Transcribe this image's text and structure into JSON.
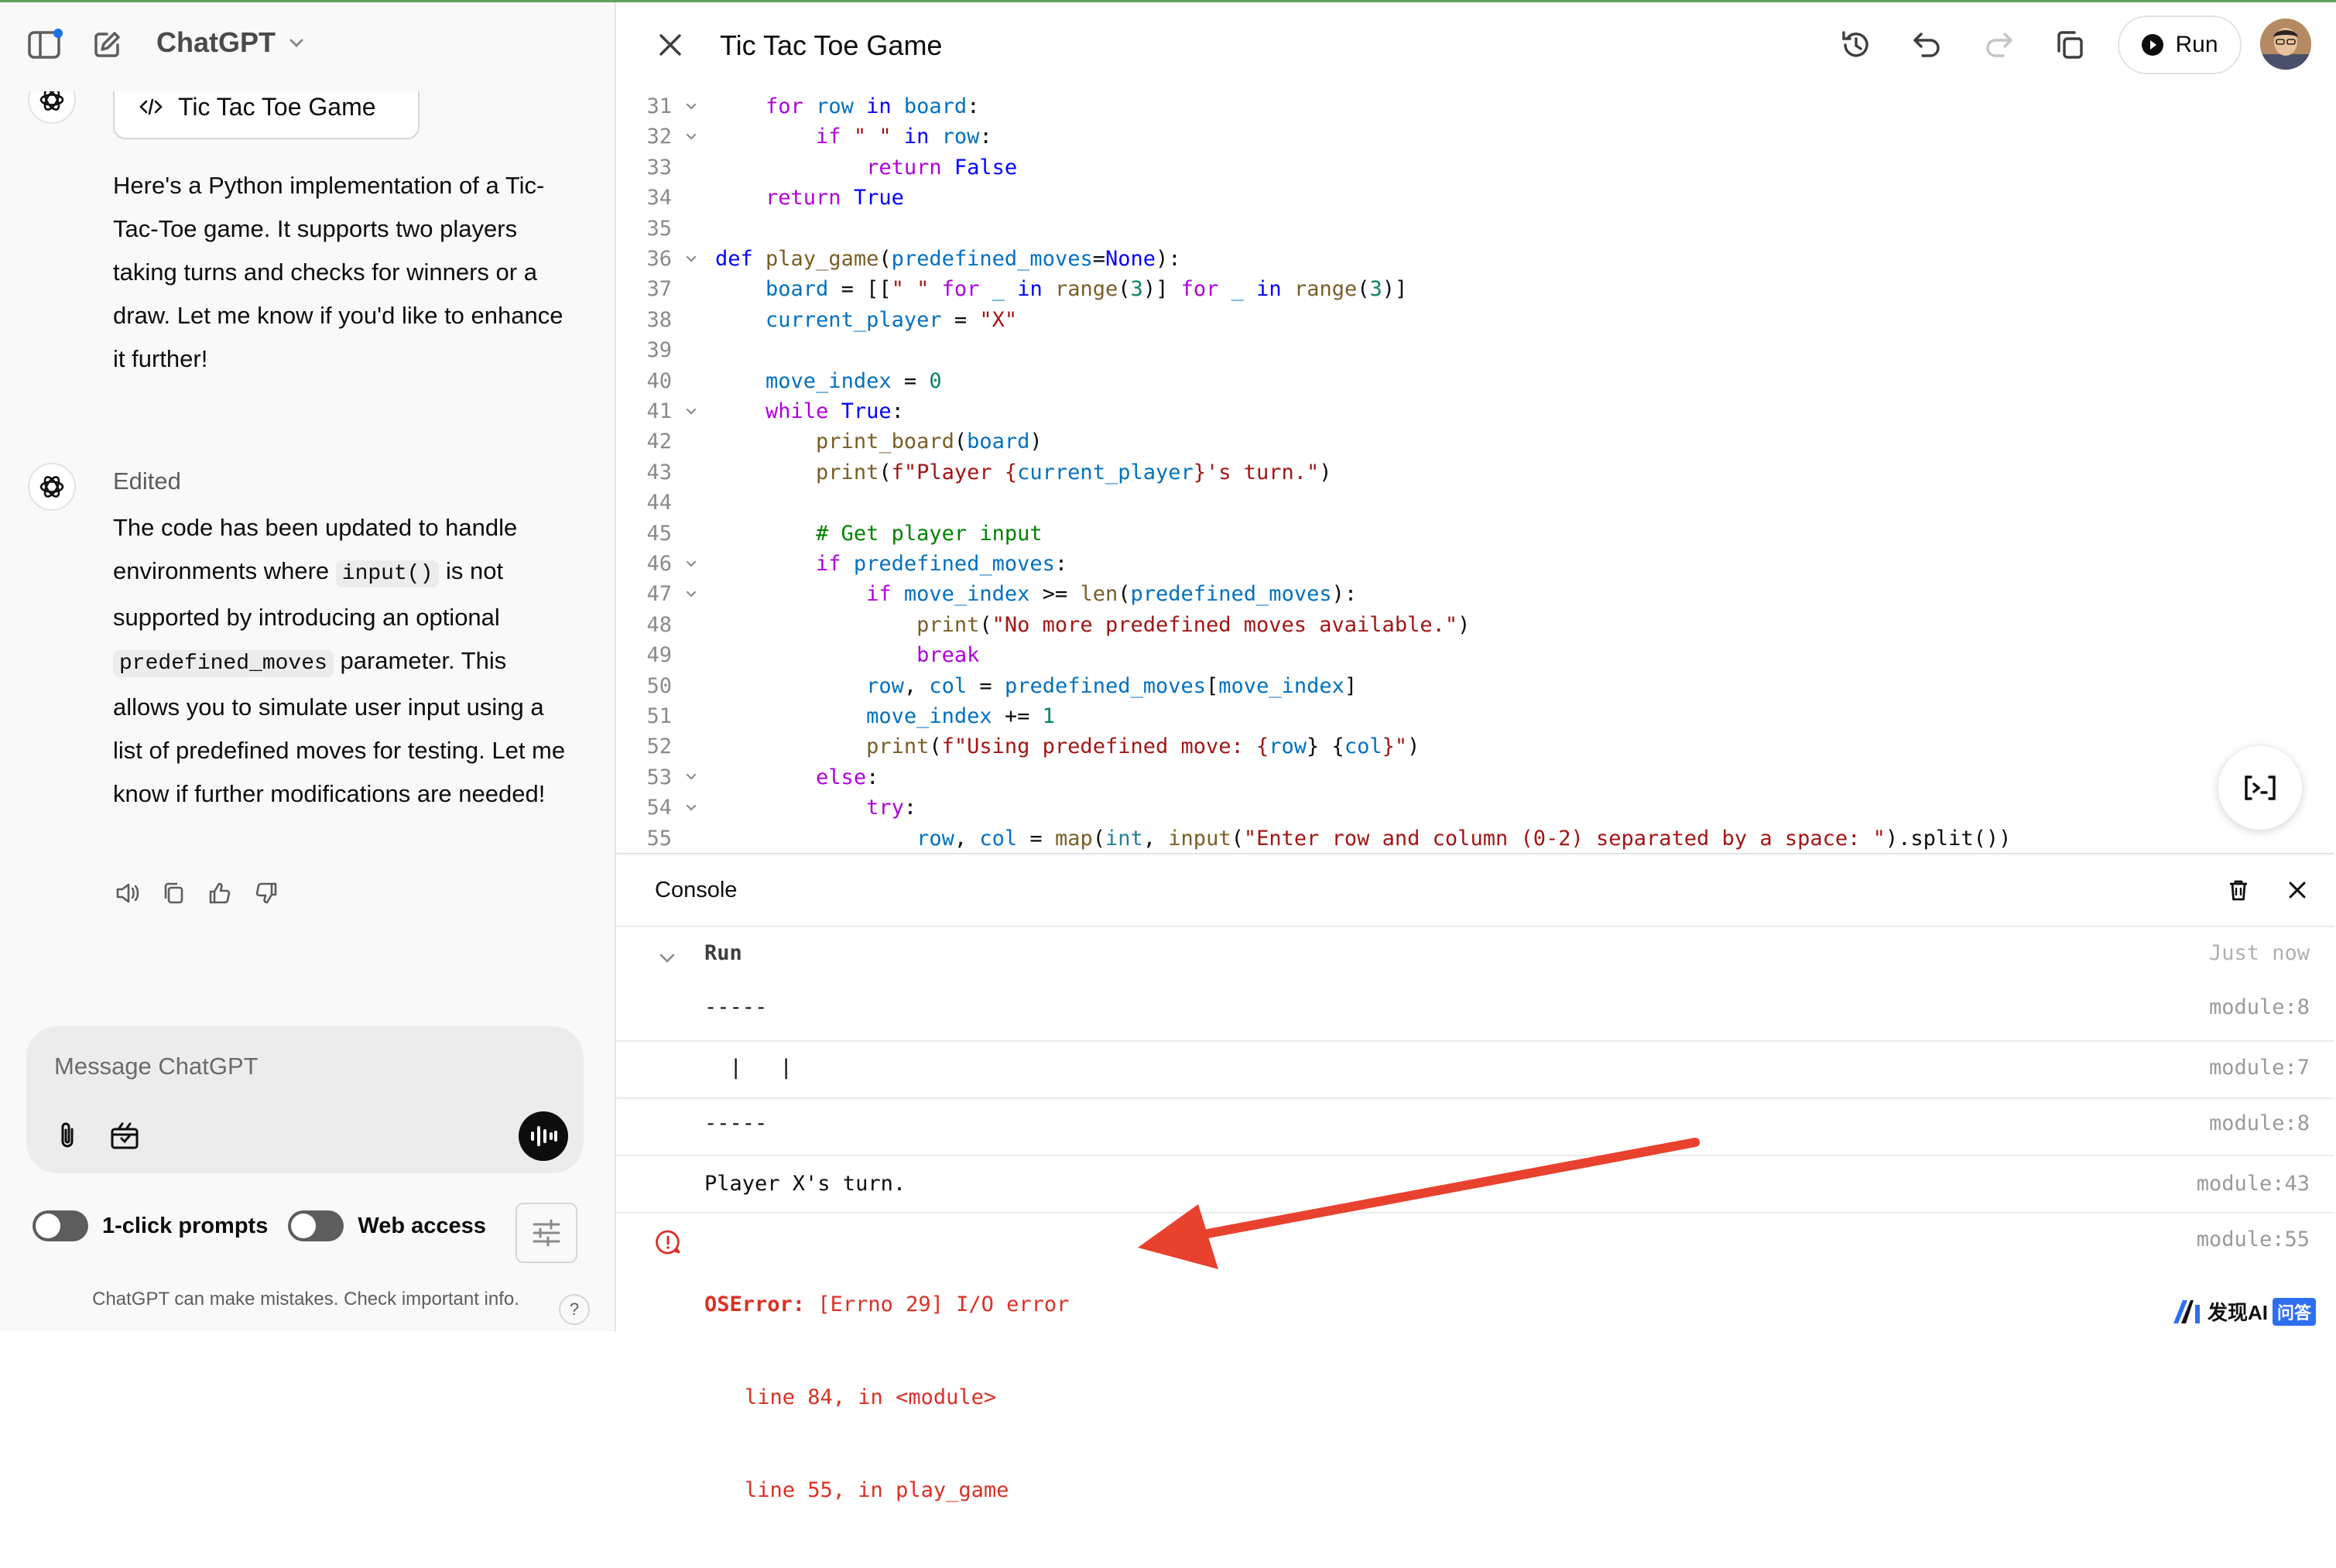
{
  "app": {
    "title": "ChatGPT"
  },
  "conversation": {
    "artifact_label": "Tic Tac Toe Game",
    "message1": "Here's a Python implementation of a Tic-Tac-Toe game. It supports two players taking turns and checks for winners or a draw. Let me know if you'd like to enhance it further!",
    "edited_label": "Edited",
    "message2": {
      "p1": "The code has been updated to handle environments where",
      "code1": "input()",
      "p2": "is not supported by introducing an optional",
      "code2": "predefined_moves",
      "p3": "parameter. This allows you to simulate user input using a list of predefined moves for testing. Let me know if further modifications are needed!"
    }
  },
  "composer": {
    "placeholder": "Message ChatGPT"
  },
  "toggles": {
    "one_click": "1-click prompts",
    "web_access": "Web access"
  },
  "footer": {
    "disclaimer": "ChatGPT can make mistakes. Check important info.",
    "help": "?"
  },
  "canvas": {
    "title": "Tic Tac Toe Game",
    "run_label": "Run"
  },
  "code_lines": [
    {
      "n": "31",
      "fold": true
    },
    {
      "n": "32",
      "fold": true
    },
    {
      "n": "33",
      "fold": false
    },
    {
      "n": "34",
      "fold": false
    },
    {
      "n": "35",
      "fold": false
    },
    {
      "n": "36",
      "fold": true
    },
    {
      "n": "37",
      "fold": false
    },
    {
      "n": "38",
      "fold": false
    },
    {
      "n": "39",
      "fold": false
    },
    {
      "n": "40",
      "fold": false
    },
    {
      "n": "41",
      "fold": true
    },
    {
      "n": "42",
      "fold": false
    },
    {
      "n": "43",
      "fold": false
    },
    {
      "n": "44",
      "fold": false
    },
    {
      "n": "45",
      "fold": false
    },
    {
      "n": "46",
      "fold": true
    },
    {
      "n": "47",
      "fold": true
    },
    {
      "n": "48",
      "fold": false
    },
    {
      "n": "49",
      "fold": false
    },
    {
      "n": "50",
      "fold": false
    },
    {
      "n": "51",
      "fold": false
    },
    {
      "n": "52",
      "fold": false
    },
    {
      "n": "53",
      "fold": true
    },
    {
      "n": "54",
      "fold": true
    },
    {
      "n": "55",
      "fold": false
    }
  ],
  "code_tokens": {
    "l31": [
      "    ",
      "for",
      " ",
      "row",
      " ",
      "in",
      " ",
      "board",
      ":"
    ],
    "l32": [
      "        ",
      "if",
      " ",
      "\" \"",
      " ",
      "in",
      " ",
      "row",
      ":"
    ],
    "l33": [
      "            ",
      "return",
      " ",
      "False"
    ],
    "l34": [
      "    ",
      "return",
      " ",
      "True"
    ],
    "l36": [
      "def",
      " ",
      "play_game",
      "(",
      "predefined_moves",
      "=",
      "None",
      "):"
    ],
    "l37": [
      "    ",
      "board",
      " = [[",
      "\" \"",
      " ",
      "for",
      " ",
      "_",
      " ",
      "in",
      " ",
      "range",
      "(",
      "3",
      ")] ",
      "for",
      " ",
      "_",
      " ",
      "in",
      " ",
      "range",
      "(",
      "3",
      ")]"
    ],
    "l38": [
      "    ",
      "current_player",
      " = ",
      "\"X\""
    ],
    "l40": [
      "    ",
      "move_index",
      " = ",
      "0"
    ],
    "l41": [
      "    ",
      "while",
      " ",
      "True",
      ":"
    ],
    "l42": [
      "        ",
      "print_board",
      "(",
      "board",
      ")"
    ],
    "l43": [
      "        ",
      "print",
      "(",
      "f\"Player {",
      "current_player",
      "}'s turn.\"",
      ")"
    ],
    "l45": [
      "        ",
      "# Get player input"
    ],
    "l46": [
      "        ",
      "if",
      " ",
      "predefined_moves",
      ":"
    ],
    "l47": [
      "            ",
      "if",
      " ",
      "move_index",
      " >= ",
      "len",
      "(",
      "predefined_moves",
      "):"
    ],
    "l48": [
      "                ",
      "print",
      "(",
      "\"No more predefined moves available.\"",
      ")"
    ],
    "l49": [
      "                ",
      "break"
    ],
    "l50": [
      "            ",
      "row",
      ", ",
      "col",
      " = ",
      "predefined_moves",
      "[",
      "move_index",
      "]"
    ],
    "l51": [
      "            ",
      "move_index",
      " += ",
      "1"
    ],
    "l52": [
      "            ",
      "print",
      "(",
      "f\"Using predefined move: {",
      "row",
      "} {",
      "col",
      "}\"",
      ")"
    ],
    "l53": [
      "        ",
      "else",
      ":"
    ],
    "l54": [
      "            ",
      "try",
      ":"
    ],
    "l55": [
      "                ",
      "row",
      ", ",
      "col",
      " = ",
      "map",
      "(",
      "int",
      ", ",
      "input",
      "(",
      "\"Enter row and column (0-2) separated by a space: \"",
      ").split())"
    ]
  },
  "console": {
    "title": "Console",
    "run_label": "Run",
    "run_time": "Just now",
    "rows": [
      {
        "text": "-----",
        "src": "module:8"
      },
      {
        "text": "  |   |",
        "src": "module:7"
      },
      {
        "text": "-----",
        "src": "module:8"
      },
      {
        "text": "Player X's turn.",
        "src": "module:43"
      }
    ],
    "error": {
      "name": "OSError:",
      "message": "[Errno 29] I/O error",
      "trace1": "line 84, in <module>",
      "trace2": "line 55, in play_game",
      "src": "module:55"
    }
  },
  "watermark": {
    "brand": "发现AI",
    "tag": "问答"
  },
  "colors": {
    "annotation_arrow": "#e8412e",
    "error": "#d93025"
  }
}
